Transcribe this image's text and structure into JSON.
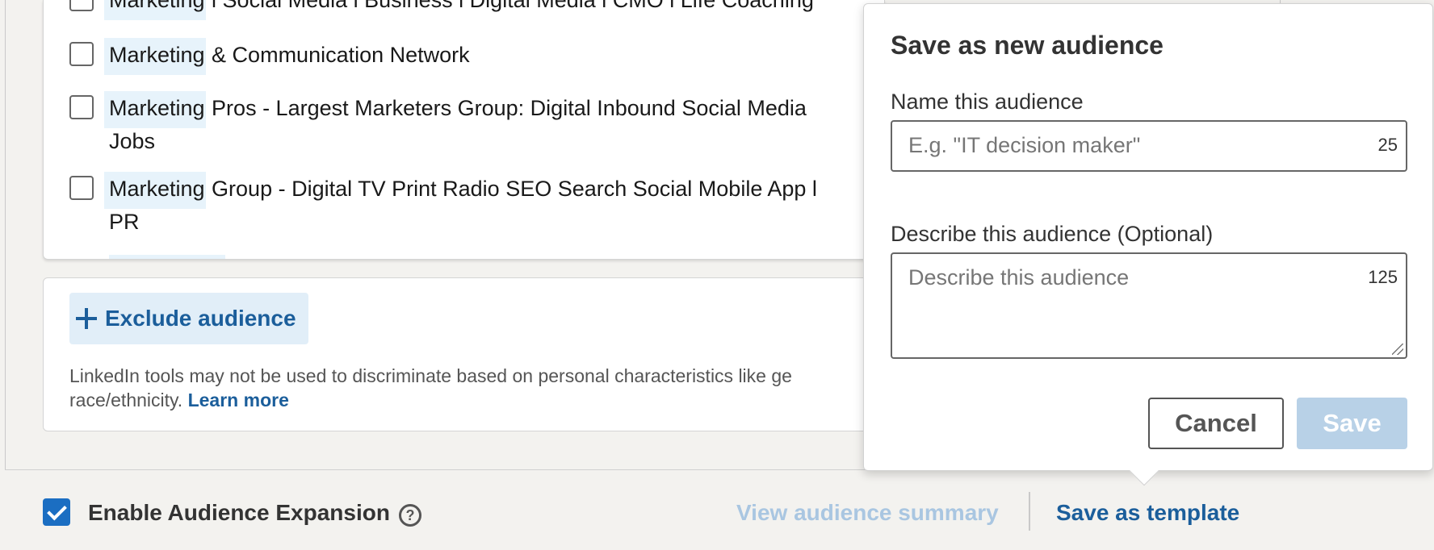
{
  "groups": {
    "items": [
      {
        "highlight": "Marketing",
        "rest": " l Social Media l Business l Digital Media l CMO l Life Coaching",
        "rest2": "",
        "checked": false
      },
      {
        "highlight": "Marketing",
        "rest": " & Communication Network",
        "rest2": "",
        "checked": false
      },
      {
        "highlight": "Marketing",
        "rest": " Pros - Largest Marketers Group: Digital Inbound Social Media",
        "rest2": "Jobs",
        "checked": false
      },
      {
        "highlight": "Marketing",
        "rest": " Group - Digital TV Print Radio SEO Search Social Mobile App l",
        "rest2": "PR",
        "checked": false
      }
    ]
  },
  "exclude": {
    "button_label": "Exclude audience",
    "disclaimer_line1": "LinkedIn tools may not be used to discriminate based on personal characteristics like ge",
    "disclaimer_line2": "race/ethnicity.",
    "learn_more": "Learn more"
  },
  "footer": {
    "expansion_label": "Enable Audience Expansion",
    "expansion_checked": true,
    "view_summary": "View audience summary",
    "save_template": "Save as template"
  },
  "popover": {
    "title": "Save as new audience",
    "name_label": "Name this audience",
    "name_placeholder": "E.g. \"IT decision maker\"",
    "name_counter": "25",
    "describe_label": "Describe this audience (Optional)",
    "describe_placeholder": "Describe this audience",
    "describe_counter": "125",
    "cancel_label": "Cancel",
    "save_label": "Save"
  },
  "colors": {
    "accent": "#1b5e9b",
    "highlight": "#e7f3fb",
    "disabled_button": "#b8d1e7"
  }
}
